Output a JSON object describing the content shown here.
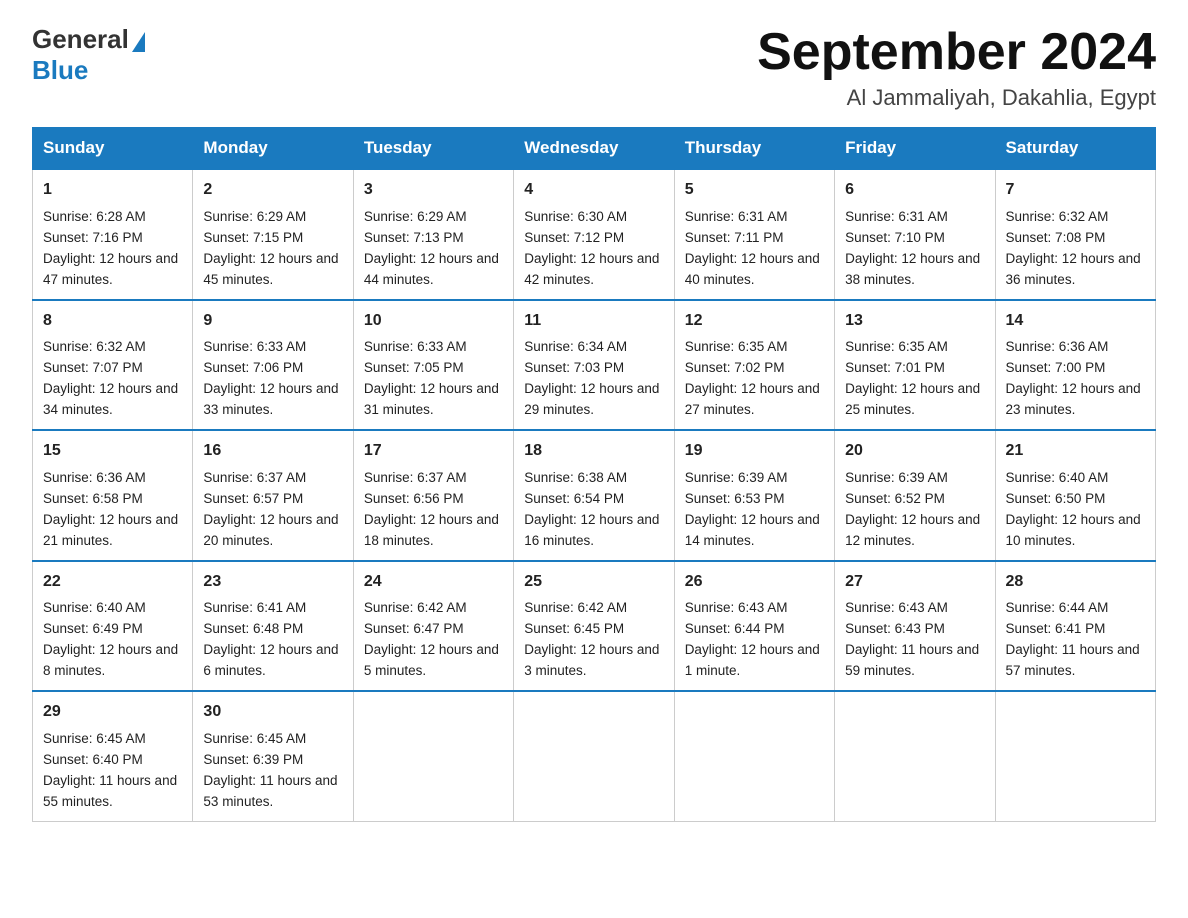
{
  "logo": {
    "general": "General",
    "blue": "Blue",
    "triangle": "▶"
  },
  "title": "September 2024",
  "location": "Al Jammaliyah, Dakahlia, Egypt",
  "weekdays": [
    "Sunday",
    "Monday",
    "Tuesday",
    "Wednesday",
    "Thursday",
    "Friday",
    "Saturday"
  ],
  "weeks": [
    [
      {
        "day": "1",
        "sunrise": "Sunrise: 6:28 AM",
        "sunset": "Sunset: 7:16 PM",
        "daylight": "Daylight: 12 hours and 47 minutes."
      },
      {
        "day": "2",
        "sunrise": "Sunrise: 6:29 AM",
        "sunset": "Sunset: 7:15 PM",
        "daylight": "Daylight: 12 hours and 45 minutes."
      },
      {
        "day": "3",
        "sunrise": "Sunrise: 6:29 AM",
        "sunset": "Sunset: 7:13 PM",
        "daylight": "Daylight: 12 hours and 44 minutes."
      },
      {
        "day": "4",
        "sunrise": "Sunrise: 6:30 AM",
        "sunset": "Sunset: 7:12 PM",
        "daylight": "Daylight: 12 hours and 42 minutes."
      },
      {
        "day": "5",
        "sunrise": "Sunrise: 6:31 AM",
        "sunset": "Sunset: 7:11 PM",
        "daylight": "Daylight: 12 hours and 40 minutes."
      },
      {
        "day": "6",
        "sunrise": "Sunrise: 6:31 AM",
        "sunset": "Sunset: 7:10 PM",
        "daylight": "Daylight: 12 hours and 38 minutes."
      },
      {
        "day": "7",
        "sunrise": "Sunrise: 6:32 AM",
        "sunset": "Sunset: 7:08 PM",
        "daylight": "Daylight: 12 hours and 36 minutes."
      }
    ],
    [
      {
        "day": "8",
        "sunrise": "Sunrise: 6:32 AM",
        "sunset": "Sunset: 7:07 PM",
        "daylight": "Daylight: 12 hours and 34 minutes."
      },
      {
        "day": "9",
        "sunrise": "Sunrise: 6:33 AM",
        "sunset": "Sunset: 7:06 PM",
        "daylight": "Daylight: 12 hours and 33 minutes."
      },
      {
        "day": "10",
        "sunrise": "Sunrise: 6:33 AM",
        "sunset": "Sunset: 7:05 PM",
        "daylight": "Daylight: 12 hours and 31 minutes."
      },
      {
        "day": "11",
        "sunrise": "Sunrise: 6:34 AM",
        "sunset": "Sunset: 7:03 PM",
        "daylight": "Daylight: 12 hours and 29 minutes."
      },
      {
        "day": "12",
        "sunrise": "Sunrise: 6:35 AM",
        "sunset": "Sunset: 7:02 PM",
        "daylight": "Daylight: 12 hours and 27 minutes."
      },
      {
        "day": "13",
        "sunrise": "Sunrise: 6:35 AM",
        "sunset": "Sunset: 7:01 PM",
        "daylight": "Daylight: 12 hours and 25 minutes."
      },
      {
        "day": "14",
        "sunrise": "Sunrise: 6:36 AM",
        "sunset": "Sunset: 7:00 PM",
        "daylight": "Daylight: 12 hours and 23 minutes."
      }
    ],
    [
      {
        "day": "15",
        "sunrise": "Sunrise: 6:36 AM",
        "sunset": "Sunset: 6:58 PM",
        "daylight": "Daylight: 12 hours and 21 minutes."
      },
      {
        "day": "16",
        "sunrise": "Sunrise: 6:37 AM",
        "sunset": "Sunset: 6:57 PM",
        "daylight": "Daylight: 12 hours and 20 minutes."
      },
      {
        "day": "17",
        "sunrise": "Sunrise: 6:37 AM",
        "sunset": "Sunset: 6:56 PM",
        "daylight": "Daylight: 12 hours and 18 minutes."
      },
      {
        "day": "18",
        "sunrise": "Sunrise: 6:38 AM",
        "sunset": "Sunset: 6:54 PM",
        "daylight": "Daylight: 12 hours and 16 minutes."
      },
      {
        "day": "19",
        "sunrise": "Sunrise: 6:39 AM",
        "sunset": "Sunset: 6:53 PM",
        "daylight": "Daylight: 12 hours and 14 minutes."
      },
      {
        "day": "20",
        "sunrise": "Sunrise: 6:39 AM",
        "sunset": "Sunset: 6:52 PM",
        "daylight": "Daylight: 12 hours and 12 minutes."
      },
      {
        "day": "21",
        "sunrise": "Sunrise: 6:40 AM",
        "sunset": "Sunset: 6:50 PM",
        "daylight": "Daylight: 12 hours and 10 minutes."
      }
    ],
    [
      {
        "day": "22",
        "sunrise": "Sunrise: 6:40 AM",
        "sunset": "Sunset: 6:49 PM",
        "daylight": "Daylight: 12 hours and 8 minutes."
      },
      {
        "day": "23",
        "sunrise": "Sunrise: 6:41 AM",
        "sunset": "Sunset: 6:48 PM",
        "daylight": "Daylight: 12 hours and 6 minutes."
      },
      {
        "day": "24",
        "sunrise": "Sunrise: 6:42 AM",
        "sunset": "Sunset: 6:47 PM",
        "daylight": "Daylight: 12 hours and 5 minutes."
      },
      {
        "day": "25",
        "sunrise": "Sunrise: 6:42 AM",
        "sunset": "Sunset: 6:45 PM",
        "daylight": "Daylight: 12 hours and 3 minutes."
      },
      {
        "day": "26",
        "sunrise": "Sunrise: 6:43 AM",
        "sunset": "Sunset: 6:44 PM",
        "daylight": "Daylight: 12 hours and 1 minute."
      },
      {
        "day": "27",
        "sunrise": "Sunrise: 6:43 AM",
        "sunset": "Sunset: 6:43 PM",
        "daylight": "Daylight: 11 hours and 59 minutes."
      },
      {
        "day": "28",
        "sunrise": "Sunrise: 6:44 AM",
        "sunset": "Sunset: 6:41 PM",
        "daylight": "Daylight: 11 hours and 57 minutes."
      }
    ],
    [
      {
        "day": "29",
        "sunrise": "Sunrise: 6:45 AM",
        "sunset": "Sunset: 6:40 PM",
        "daylight": "Daylight: 11 hours and 55 minutes."
      },
      {
        "day": "30",
        "sunrise": "Sunrise: 6:45 AM",
        "sunset": "Sunset: 6:39 PM",
        "daylight": "Daylight: 11 hours and 53 minutes."
      },
      null,
      null,
      null,
      null,
      null
    ]
  ]
}
